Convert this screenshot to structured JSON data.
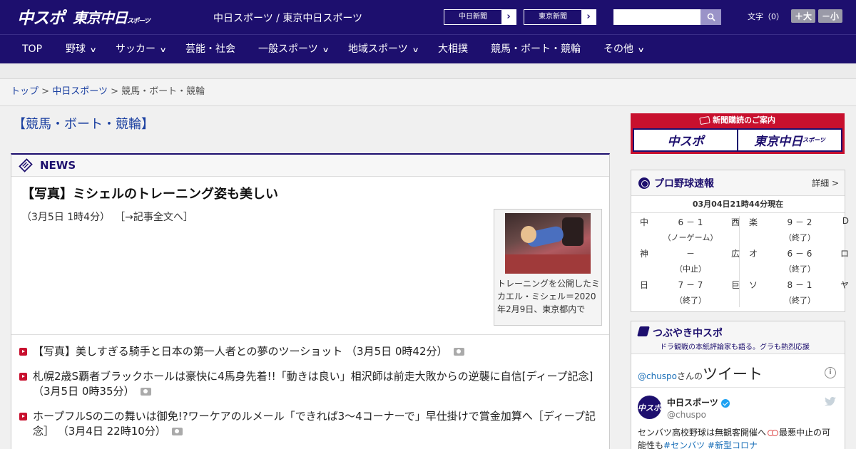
{
  "header": {
    "logo_primary": "中スポ",
    "logo_secondary": "東京中日",
    "logo_secondary_suffix": "スポーツ",
    "site_name": "中日スポーツ / 東京中日スポーツ",
    "ext_links": [
      "中日新聞",
      "東京新聞"
    ],
    "search_placeholder": "",
    "font_size_label": "文字（0）",
    "font_bigger": "＋大",
    "font_smaller": "－小"
  },
  "nav": {
    "items": [
      {
        "label": "TOP",
        "dropdown": false
      },
      {
        "label": "野球",
        "dropdown": true
      },
      {
        "label": "サッカー",
        "dropdown": true
      },
      {
        "label": "芸能・社会",
        "dropdown": false
      },
      {
        "label": "一般スポーツ",
        "dropdown": true
      },
      {
        "label": "地域スポーツ",
        "dropdown": true
      },
      {
        "label": "大相撲",
        "dropdown": false
      },
      {
        "label": "競馬・ボート・競輪",
        "dropdown": false
      },
      {
        "label": "その他",
        "dropdown": true
      }
    ]
  },
  "breadcrumb": {
    "items": [
      "トップ",
      "中日スポーツ",
      "競馬・ボート・競輪"
    ],
    "separator": ">"
  },
  "page_title": "【競馬・ボート・競輪】",
  "news": {
    "header_label": "NEWS",
    "lead": {
      "title": "【写真】ミシェルのトレーニング姿も美しい",
      "date": "（3月5日 1時4分）",
      "link": "［→記事全文へ］",
      "caption": "トレーニングを公開したミカエル・ミシェル＝2020年2月9日、東京都内で"
    },
    "items": [
      {
        "text": "【写真】美しすぎる騎手と日本の第一人者との夢のツーショット （3月5日 0時42分）",
        "photo": true
      },
      {
        "text": "札幌2歳S覇者ブラックホールは豪快に4馬身先着!!「動きは良い」相沢師は前走大敗からの逆襲に自信[ディープ記念] （3月5日 0時35分）",
        "photo": true
      },
      {
        "text": "ホープフルSの二の舞いは御免!?ワーケアのルメール「できれば3～4コーナーで」早仕掛けで賞金加算へ［ディープ記念］ （3月4日 22時10分）",
        "photo": true
      }
    ]
  },
  "subscribe": {
    "head": "新聞購読のご案内",
    "left": "中スポ",
    "right": "東京中日",
    "right_suffix": "スポーツ"
  },
  "baseball": {
    "title": "プロ野球速報",
    "more": "詳細 >",
    "timestamp": "03月04日21時44分現在",
    "games": [
      {
        "home": "中",
        "score": "6 － 1",
        "away": "西",
        "status": "（ノーゲーム）"
      },
      {
        "home": "楽",
        "score": "9 － 2",
        "away": "D",
        "status": "（終了）"
      },
      {
        "home": "神",
        "score": "－",
        "away": "広",
        "status": "（中止）"
      },
      {
        "home": "オ",
        "score": "6 － 6",
        "away": "ロ",
        "status": "（終了）"
      },
      {
        "home": "日",
        "score": "7 － 7",
        "away": "巨",
        "status": "（終了）"
      },
      {
        "home": "ソ",
        "score": "8 － 1",
        "away": "ヤ",
        "status": "（終了）"
      }
    ]
  },
  "tsubuyaki": {
    "title": "つぶやき中スポ",
    "subtitle": "ドラ観戦の本紙評論家も語る。グラも熱烈応援",
    "tw_handle_link": "@chuspo",
    "tw_handle_suffix": "さんの",
    "tw_title": "ツイート",
    "tweet": {
      "avatar": "中スポ",
      "name": "中日スポーツ",
      "handle": "@chuspo",
      "text_a": "センバツ高校野球は無観客開催へ",
      "text_b": "最悪中止の可能性も",
      "tag1": "#センバツ",
      "tag2": "#新型コロナ"
    }
  },
  "colors": {
    "brand_navy": "#1d0f6e",
    "accent_red": "#c8102e",
    "link_blue": "#1a3fa0"
  }
}
